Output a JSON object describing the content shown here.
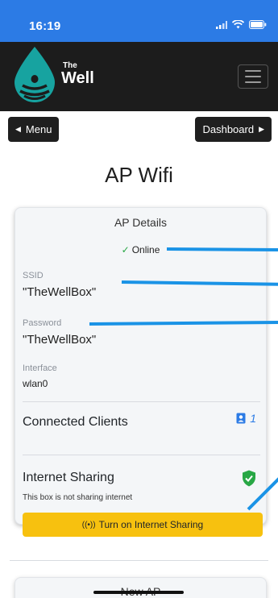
{
  "status_bar": {
    "time": "16:19"
  },
  "header": {
    "logo_small": "The",
    "logo_big": "Well"
  },
  "nav": {
    "menu_label": "Menu",
    "dashboard_label": "Dashboard"
  },
  "page": {
    "title": "AP Wifi"
  },
  "card": {
    "header": "AP Details",
    "status": "Online",
    "ssid_label": "SSID",
    "ssid_value": "\"TheWellBox\"",
    "password_label": "Password",
    "password_value": "\"TheWellBox\"",
    "interface_label": "Interface",
    "interface_value": "wlan0",
    "clients_label": "Connected Clients",
    "clients_count": "1",
    "sharing_label": "Internet Sharing",
    "sharing_note": "This box is not sharing internet",
    "sharing_button": "Turn on Internet Sharing"
  },
  "card2": {
    "header": "New AP"
  },
  "colors": {
    "status_bar": "#2c7be5",
    "header_bg": "#1c1c1c",
    "accent_yellow": "#f7c10f",
    "online_green": "#28a745",
    "annotation_blue": "#1a93e6",
    "logo_teal": "#17a3a0"
  },
  "icons": [
    "signal-icon",
    "wifi-icon",
    "battery-icon",
    "water-drop-logo-icon",
    "hamburger-icon",
    "caret-left-icon",
    "caret-right-icon",
    "check-icon",
    "client-badge-icon",
    "shield-check-icon",
    "broadcast-icon"
  ]
}
